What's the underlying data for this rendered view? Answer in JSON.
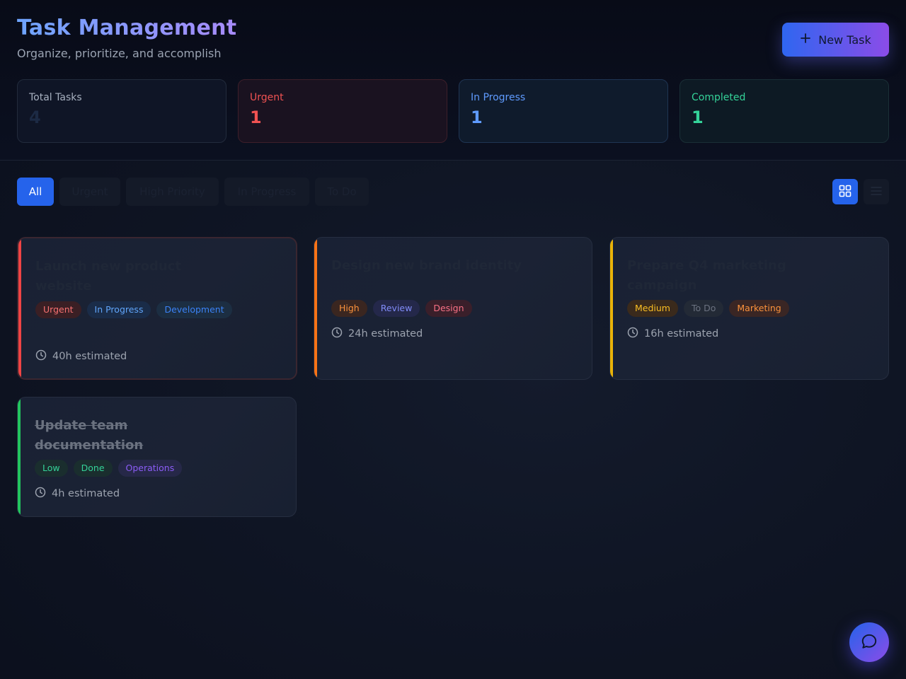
{
  "header": {
    "title": "Task Management",
    "subtitle": "Organize, prioritize, and accomplish",
    "new_task_label": "New Task"
  },
  "stats": [
    {
      "label": "Total Tasks",
      "value": "4"
    },
    {
      "label": "Urgent",
      "value": "1"
    },
    {
      "label": "In Progress",
      "value": "1"
    },
    {
      "label": "Completed",
      "value": "1"
    }
  ],
  "filters": [
    {
      "label": "All",
      "active": true
    },
    {
      "label": "Urgent",
      "active": false
    },
    {
      "label": "High Priority",
      "active": false
    },
    {
      "label": "In Progress",
      "active": false
    },
    {
      "label": "To Do",
      "active": false
    }
  ],
  "view_toggle": {
    "selected": "grid",
    "icons": [
      "grid-icon",
      "list-icon"
    ]
  },
  "tasks": [
    {
      "title": "Launch new product website",
      "priority": "Urgent",
      "status": "In Progress",
      "category": "Development",
      "estimate": "40h estimated",
      "accent": "#ef4444"
    },
    {
      "title": "Design new brand identity",
      "priority": "High",
      "status": "Review",
      "category": "Design",
      "estimate": "24h estimated",
      "accent": "#f97316"
    },
    {
      "title": "Prepare Q4 marketing campaign",
      "priority": "Medium",
      "status": "To Do",
      "category": "Marketing",
      "estimate": "16h estimated",
      "accent": "#eab308"
    },
    {
      "title": "Update team documentation",
      "priority": "Low",
      "status": "Done",
      "category": "Operations",
      "estimate": "4h estimated",
      "accent": "#22c55e",
      "completed": true
    }
  ],
  "colors": {
    "accent_blue": "#2563eb",
    "accent_purple": "#8b4ce8",
    "urgent": "#ef4444",
    "high": "#f97316",
    "medium": "#eab308",
    "low": "#22c55e"
  },
  "fab": {
    "icon": "chat-icon"
  }
}
